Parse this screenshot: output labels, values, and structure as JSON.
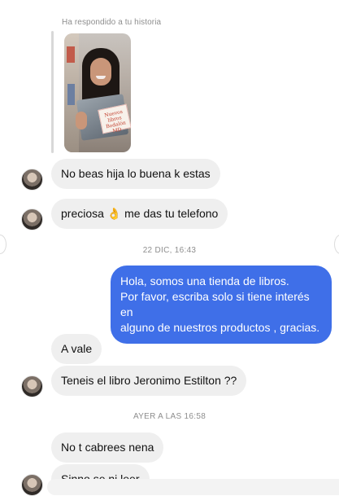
{
  "story_reply": {
    "label": "Ha respondido a tu historia",
    "sticker_text": "Nuevos libros Bodalón MD"
  },
  "messages": [
    {
      "side": "in",
      "text": "No beas hija lo buena k estas"
    },
    {
      "side": "in",
      "text_before": "preciosa ",
      "emoji": "👌",
      "text_after": " me das tu telefono"
    },
    {
      "type": "timestamp",
      "text": "22 DIC, 16:43"
    },
    {
      "side": "out",
      "lines": [
        "Hola, somos una tienda de libros.",
        "Por favor, escriba solo si tiene interés en",
        "alguno de nuestros productos , gracias."
      ]
    },
    {
      "side": "in",
      "text": "A vale"
    },
    {
      "side": "in",
      "text": "Teneis el libro Jeronimo Estilton ??"
    },
    {
      "type": "timestamp",
      "text": "AYER A LAS 16:58"
    },
    {
      "side": "in",
      "text": "No t cabrees nena"
    },
    {
      "side": "in",
      "text": "Sinno se ni leer"
    }
  ],
  "colors": {
    "incoming_bubble": "#efefef",
    "outgoing_bubble": "#3f6fe8",
    "timestamp": "#8e8e8e"
  }
}
